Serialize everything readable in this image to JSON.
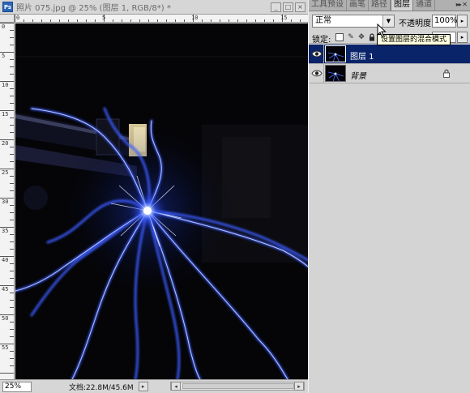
{
  "document": {
    "title": "照片 075.jpg @ 25% (图层 1, RGB/8*) *",
    "zoom": "25%",
    "doc_info": "文档:22.8M/45.6M"
  },
  "rulers": {
    "top_labels": [
      "0",
      "5",
      "1\n0",
      "1\n5"
    ],
    "left_labels": [
      "0",
      "5",
      "1\n0",
      "1\n5",
      "2\n0",
      "2\n5",
      "3\n0",
      "3\n5",
      "4\n0",
      "4\n5",
      "5\n0",
      "5\n5"
    ]
  },
  "panel": {
    "tabs": [
      "工具预设",
      "画笔",
      "路径",
      "图层",
      "通道"
    ],
    "active_tab": "图层",
    "blend_mode": "正常",
    "opacity_label": "不透明度:",
    "opacity_value": "100%",
    "lock_label": "锁定:",
    "tooltip": "设置图层的混合模式",
    "layers": [
      {
        "name": "图层 1",
        "selected": true,
        "locked": false
      },
      {
        "name": "背景",
        "selected": false,
        "locked": true
      }
    ]
  },
  "icons": {
    "app": "photoshop-logo-icon",
    "eye": "eye-icon",
    "lock": "lock-icon"
  },
  "colors": {
    "selection": "#0a246a",
    "light_blue": "#4a6cff",
    "tooltip_bg": "#ffffe1"
  }
}
